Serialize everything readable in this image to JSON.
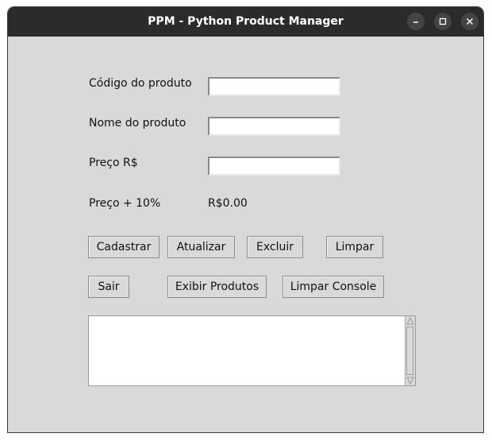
{
  "window": {
    "title": "PPM - Python Product Manager",
    "controls": [
      "minimize-icon",
      "maximize-icon",
      "close-icon"
    ]
  },
  "form": {
    "codigo_label": "Código do produto",
    "codigo_value": "",
    "nome_label": "Nome do produto",
    "nome_value": "",
    "preco_label": "Preço R$",
    "preco_value": "",
    "preco10_label": "Preço + 10%",
    "preco10_value": "R$0.00"
  },
  "buttons": {
    "cadastrar": "Cadastrar",
    "atualizar": "Atualizar",
    "excluir": "Excluir",
    "limpar": "Limpar",
    "sair": "Sair",
    "exibir": "Exibir Produtos",
    "limpar_console": "Limpar Console"
  },
  "console": {
    "text": ""
  },
  "colors": {
    "window_bg": "#d9d9d9",
    "titlebar_bg": "#2b2b2b",
    "entry_bg": "#ffffff"
  }
}
